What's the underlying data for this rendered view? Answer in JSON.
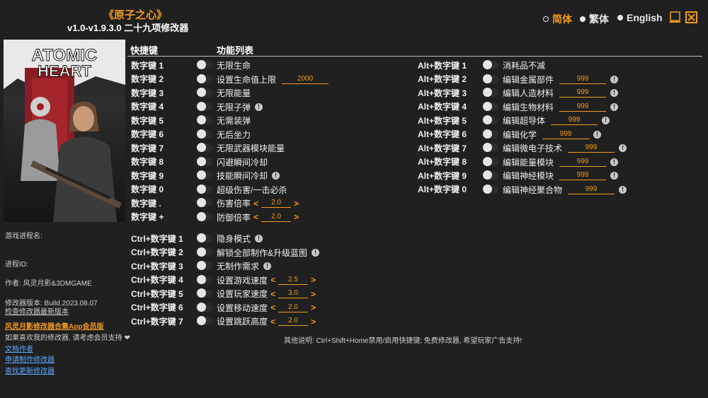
{
  "header": {
    "title": "《原子之心》",
    "version": "v1.0-v1.9.3.0 二十九项修改器"
  },
  "languages": [
    {
      "label": "简体",
      "active": true
    },
    {
      "label": "繁体",
      "active": false
    },
    {
      "label": "English",
      "active": false
    }
  ],
  "cover": {
    "logo_line1": "ATOMIC",
    "logo_line2": "HEART"
  },
  "info": {
    "process": "游戏进程名:",
    "pid": "进程ID:",
    "author": "作者: 风灵月影&3DMGAME",
    "build": "修改器版本: Build.2023.08.07",
    "check_update": "检查修改器最新版本",
    "app_member": "风灵月影修改器合集App会员版",
    "support": "如果喜欢我的修改器, 请考虑会员支持 ❤",
    "links": [
      "文档作者",
      "申请制作修改器",
      "查找更新修改器"
    ]
  },
  "columns": {
    "hotkey": "快捷键",
    "features": "功能列表"
  },
  "left_features": [
    {
      "hotkey": "数字键 1",
      "name": "无限生命"
    },
    {
      "hotkey": "数字键 2",
      "name": "设置生命值上限",
      "value": "2000"
    },
    {
      "hotkey": "数字键 3",
      "name": "无限能量"
    },
    {
      "hotkey": "数字键 4",
      "name": "无限子弹",
      "info": true
    },
    {
      "hotkey": "数字键 5",
      "name": "无需装弹"
    },
    {
      "hotkey": "数字键 6",
      "name": "无后坐力"
    },
    {
      "hotkey": "数字键 7",
      "name": "无限武器模块能量"
    },
    {
      "hotkey": "数字键 8",
      "name": "闪避瞬间冷却"
    },
    {
      "hotkey": "数字键 9",
      "name": "技能瞬间冷却",
      "info": true
    },
    {
      "hotkey": "数字键 0",
      "name": "超级伤害/一击必杀"
    },
    {
      "hotkey": "数字键 .",
      "name": "伤害倍率",
      "stepper": "2.0"
    },
    {
      "hotkey": "数字键 +",
      "name": "防御倍率",
      "stepper": "2.0"
    }
  ],
  "ctrl_features": [
    {
      "hotkey": "Ctrl+数字键 1",
      "name": "隐身模式",
      "info": true
    },
    {
      "hotkey": "Ctrl+数字键 2",
      "name": "解锁全部制作&升级蓝图",
      "info": true
    },
    {
      "hotkey": "Ctrl+数字键 3",
      "name": "无制作需求",
      "info": true
    },
    {
      "hotkey": "Ctrl+数字键 4",
      "name": "设置游戏速度",
      "stepper": "2.5"
    },
    {
      "hotkey": "Ctrl+数字键 5",
      "name": "设置玩家速度",
      "stepper": "3.0"
    },
    {
      "hotkey": "Ctrl+数字键 6",
      "name": "设置移动速度",
      "stepper": "2.0"
    },
    {
      "hotkey": "Ctrl+数字键 7",
      "name": "设置跳跃高度",
      "stepper": "2.0"
    }
  ],
  "alt_features": [
    {
      "hotkey": "Alt+数字键 1",
      "name": "消耗品不减"
    },
    {
      "hotkey": "Alt+数字键 2",
      "name": "编辑金属部件",
      "value": "999",
      "info": true
    },
    {
      "hotkey": "Alt+数字键 3",
      "name": "编辑人造材料",
      "value": "999",
      "info": true
    },
    {
      "hotkey": "Alt+数字键 4",
      "name": "编辑生物材料",
      "value": "999",
      "info": true
    },
    {
      "hotkey": "Alt+数字键 5",
      "name": "编辑超导体",
      "value": "999",
      "info": true
    },
    {
      "hotkey": "Alt+数字键 6",
      "name": "编辑化学",
      "value": "999",
      "info": true
    },
    {
      "hotkey": "Alt+数字键 7",
      "name": "编辑微电子技术",
      "value": "999",
      "info": true
    },
    {
      "hotkey": "Alt+数字键 8",
      "name": "编辑能量模块",
      "value": "999",
      "info": true
    },
    {
      "hotkey": "Alt+数字键 9",
      "name": "编辑神经模块",
      "value": "999",
      "info": true
    },
    {
      "hotkey": "Alt+数字键 0",
      "name": "编辑神经聚合物",
      "value": "999",
      "info": true
    }
  ],
  "footer": "其他说明: Ctrl+Shift+Home禁用/启用快捷键; 免费修改器, 希望玩家广告支持!",
  "colors": {
    "accent": "#f39a1e",
    "background": "#202020",
    "link": "#5aa8ff"
  }
}
